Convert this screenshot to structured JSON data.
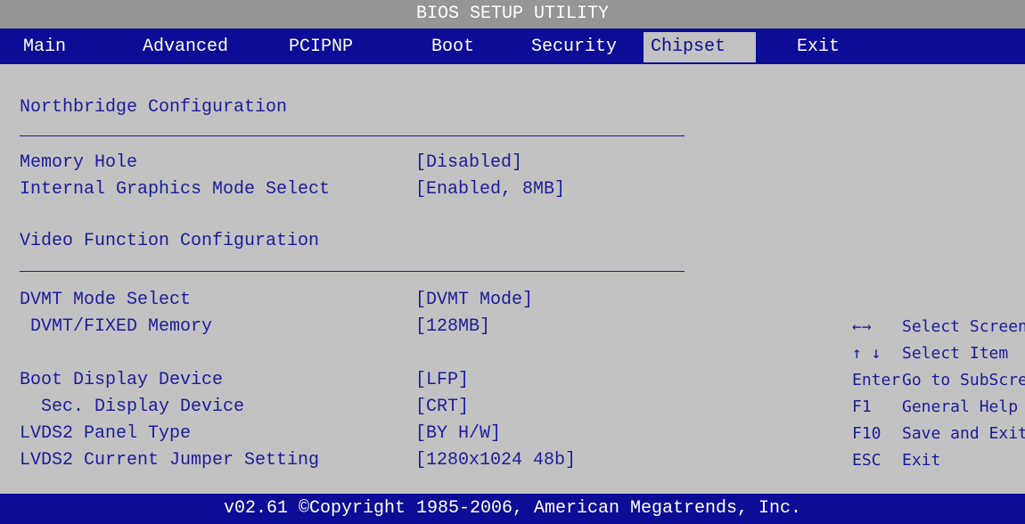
{
  "title": "BIOS SETUP UTILITY",
  "menu": {
    "tabs": [
      {
        "label": "Main"
      },
      {
        "label": "Advanced"
      },
      {
        "label": "PCIPNP"
      },
      {
        "label": "Boot"
      },
      {
        "label": "Security"
      },
      {
        "label": "Chipset"
      },
      {
        "label": "Exit"
      }
    ],
    "active": "Chipset"
  },
  "sections": {
    "northbridge_title": "Northbridge Configuration",
    "video_title": "Video Function Configuration"
  },
  "settings": [
    {
      "label": "Memory Hole",
      "value": "[Disabled]"
    },
    {
      "label": "Internal Graphics Mode Select",
      "value": "[Enabled, 8MB]"
    },
    {
      "label": "DVMT Mode Select",
      "value": "[DVMT Mode]"
    },
    {
      "label": "DVMT/FIXED Memory",
      "value": "[128MB]"
    },
    {
      "label": "Boot Display Device",
      "value": "[LFP]"
    },
    {
      "label": "Sec. Display Device",
      "value": "[CRT]"
    },
    {
      "label": "LVDS2 Panel Type",
      "value": "[BY H/W]"
    },
    {
      "label": "LVDS2 Current Jumper Setting",
      "value": "[1280x1024 48b]"
    }
  ],
  "help": [
    {
      "key": "←→",
      "desc": "Select Screen"
    },
    {
      "key": "↑ ↓",
      "desc": "Select Item"
    },
    {
      "key": "Enter",
      "desc": "Go to SubScreen"
    },
    {
      "key": "F1",
      "desc": "General Help"
    },
    {
      "key": "F10",
      "desc": "Save and Exit"
    },
    {
      "key": "ESC",
      "desc": "Exit"
    }
  ],
  "footer": "v02.61 ©Copyright 1985-2006, American Megatrends, Inc.",
  "colors": {
    "background": "#c2c2c2",
    "menu_bar": "#0c0c96",
    "title_bar": "#969696",
    "text": "#1c1c9a"
  }
}
